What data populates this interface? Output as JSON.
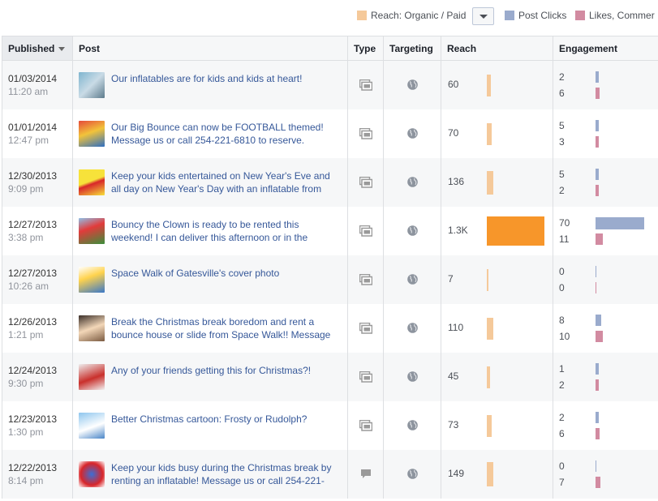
{
  "legend": {
    "reach_label": "Reach: Organic / Paid",
    "clicks_label": "Post Clicks",
    "likes_label": "Likes, Commer",
    "colors": {
      "reach": "#f5c99a",
      "reach_highlight": "#f7962a",
      "clicks": "#9aabcd",
      "likes": "#d28ba1"
    }
  },
  "table": {
    "headers": {
      "published": "Published",
      "post": "Post",
      "type": "Type",
      "targeting": "Targeting",
      "reach": "Reach",
      "engagement": "Engagement"
    },
    "reach_max": 1300,
    "engagement_max": 70,
    "rows": [
      {
        "date": "01/03/2014",
        "time": "11:20 am",
        "text": "Our inflatables are for kids and kids at heart!",
        "type": "photo",
        "thumb": "kid-photo",
        "reach": "60",
        "reach_value": 60,
        "clicks": "2",
        "clicks_value": 2,
        "likes": "6",
        "likes_value": 6
      },
      {
        "date": "01/01/2014",
        "time": "12:47 pm",
        "text": "Our Big Bounce can now be FOOTBALL themed! Message us or call 254-221-6810 to reserve.",
        "type": "photo",
        "thumb": "bounce-house-photo",
        "reach": "70",
        "reach_value": 70,
        "clicks": "5",
        "clicks_value": 5,
        "likes": "3",
        "likes_value": 3
      },
      {
        "date": "12/30/2013",
        "time": "9:09 pm",
        "text": "Keep your kids entertained on New Year's Eve and all day on New Year's Day with an inflatable from",
        "type": "photo",
        "thumb": "special-offer-image",
        "reach": "136",
        "reach_value": 136,
        "clicks": "5",
        "clicks_value": 5,
        "likes": "2",
        "likes_value": 2
      },
      {
        "date": "12/27/2013",
        "time": "3:38 pm",
        "text": "Bouncy the Clown is ready to be rented this weekend! I can deliver this afternoon or in the",
        "type": "photo",
        "thumb": "clown-bounce-photo",
        "reach": "1.3K",
        "reach_value": 1300,
        "clicks": "70",
        "clicks_value": 70,
        "likes": "11",
        "likes_value": 11
      },
      {
        "date": "12/27/2013",
        "time": "10:26 am",
        "text": "Space Walk of Gatesville's cover photo",
        "type": "photo",
        "thumb": "cover-photo",
        "reach": "7",
        "reach_value": 7,
        "clicks": "0",
        "clicks_value": 0,
        "likes": "0",
        "likes_value": 0
      },
      {
        "date": "12/26/2013",
        "time": "1:21 pm",
        "text": "Break the Christmas break boredom and rent a bounce house or slide from Space Walk!! Message",
        "type": "photo",
        "thumb": "child-photo",
        "reach": "110",
        "reach_value": 110,
        "clicks": "8",
        "clicks_value": 8,
        "likes": "10",
        "likes_value": 10
      },
      {
        "date": "12/24/2013",
        "time": "9:30 pm",
        "text": "Any of your friends getting this for Christmas?!",
        "type": "photo",
        "thumb": "santa-photo",
        "reach": "45",
        "reach_value": 45,
        "clicks": "1",
        "clicks_value": 1,
        "likes": "2",
        "likes_value": 2
      },
      {
        "date": "12/23/2013",
        "time": "1:30 pm",
        "text": "Better Christmas cartoon: Frosty or Rudolph?",
        "type": "photo",
        "thumb": "snowman-cartoon",
        "reach": "73",
        "reach_value": 73,
        "clicks": "2",
        "clicks_value": 2,
        "likes": "6",
        "likes_value": 6
      },
      {
        "date": "12/22/2013",
        "time": "8:14 pm",
        "text": "Keep your kids busy during the Christmas break by renting an inflatable! Message us or call 254-221-",
        "type": "status",
        "thumb": "inflatable-photo",
        "reach": "149",
        "reach_value": 149,
        "clicks": "0",
        "clicks_value": 0,
        "likes": "7",
        "likes_value": 7
      }
    ]
  }
}
